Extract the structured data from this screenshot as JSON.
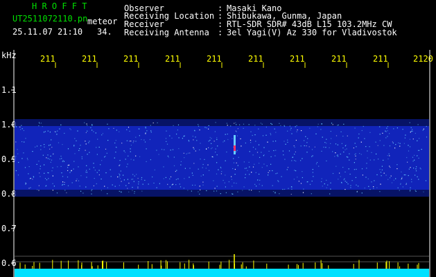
{
  "program": {
    "title": "H R O F F T",
    "filename": "UT2511072110.pn",
    "filename_suffix": "meteor",
    "datetime": "25.11.07 21:10",
    "counter": "34."
  },
  "header": {
    "rows": [
      {
        "label": "Observer",
        "sep": ":",
        "value": "Masaki Kano"
      },
      {
        "label": "Receiving Location",
        "sep": ":",
        "value": "Shibukawa, Gunma, Japan"
      },
      {
        "label": "Receiver",
        "sep": ":",
        "value": "RTL-SDR SDR# 43dB L15 103.2MHz CW"
      },
      {
        "label": "Receiving Antenna",
        "sep": ":",
        "value": "3el Yagi(V) Az 330 for Vladivostok"
      }
    ]
  },
  "frequency_axis": {
    "unit": "kHz",
    "ticks": [
      "1.1",
      "1.0",
      "0.9",
      "0.8",
      "0.7",
      "0.6"
    ]
  },
  "time_axis": {
    "ticks": [
      "211",
      "211",
      "211",
      "211",
      "211",
      "211",
      "211",
      "211",
      "211",
      "2120"
    ]
  },
  "colors": {
    "background": "#000000",
    "label_text": "#ffffff",
    "title_text": "#00e000",
    "axis_text": "#ffff00",
    "noise_band": "#1a33ff",
    "noise_bright": "#66ccff",
    "amplitude_bar": "#00e0ff",
    "spike": "#ffff00"
  }
}
